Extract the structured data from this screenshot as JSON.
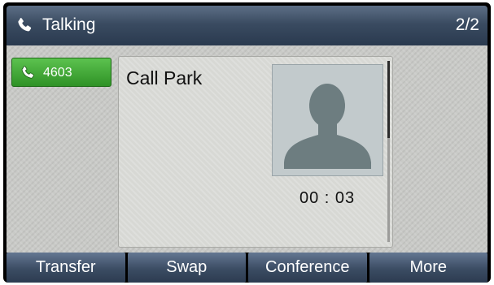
{
  "header": {
    "icon": "phone-handset-icon",
    "title": "Talking",
    "call_count": "2/2"
  },
  "line_key": {
    "icon": "phone-handset-icon",
    "label": "4603",
    "color": "#3aa82f"
  },
  "call": {
    "name": "Call Park",
    "avatar": "person-silhouette-icon",
    "duration": "00 : 03"
  },
  "softkeys": [
    {
      "label": "Transfer"
    },
    {
      "label": "Swap"
    },
    {
      "label": "Conference"
    },
    {
      "label": "More"
    }
  ]
}
